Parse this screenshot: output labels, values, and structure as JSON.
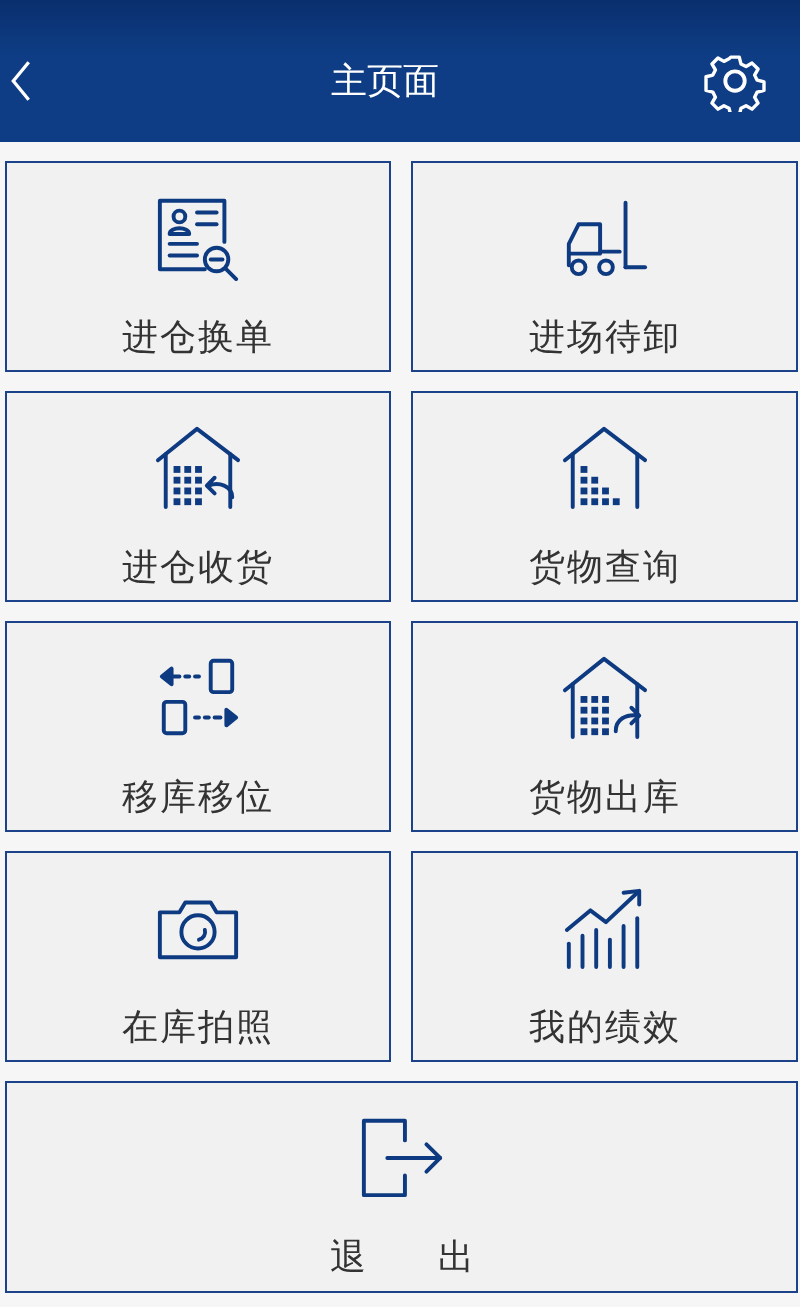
{
  "header": {
    "title": "主页面"
  },
  "tiles": [
    {
      "label": "进仓换单",
      "kind": "document"
    },
    {
      "label": "进场待卸",
      "kind": "forklift"
    },
    {
      "label": "进仓收货",
      "kind": "house-in"
    },
    {
      "label": "货物查询",
      "kind": "house"
    },
    {
      "label": "移库移位",
      "kind": "transfer"
    },
    {
      "label": "货物出库",
      "kind": "house-out"
    },
    {
      "label": "在库拍照",
      "kind": "camera"
    },
    {
      "label": "我的绩效",
      "kind": "chart"
    }
  ],
  "exit": {
    "label": "退　出"
  }
}
